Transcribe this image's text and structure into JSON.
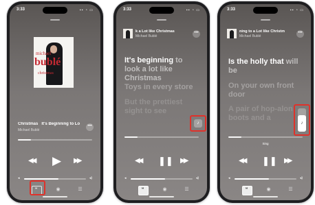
{
  "status": {
    "time_1": "3:33",
    "time_2": "3:33",
    "time_3": "3:33",
    "icons": "▪▪ ◔ ▭"
  },
  "now_playing": {
    "song": "Christmas",
    "song_full": "It's Beginning to Lo",
    "artist": "Michael Bublé",
    "artwork": {
      "line1": "michael",
      "line2": "bublé",
      "line3": "christmas"
    }
  },
  "mini_player_2": {
    "title": "k a Lot like Christmas",
    "artist": "Michael Bublé"
  },
  "mini_player_3": {
    "title": "ning to a Lot like Christm",
    "artist": "Michael Bublé"
  },
  "lyrics_2": {
    "current_lit": "It's beginning",
    "current_dim": " to look a lot like Christmas",
    "next_1": "Toys in every store",
    "next_2": "But the prettiest sight to see"
  },
  "lyrics_3": {
    "current_lit": "Is the holly that",
    "current_dim": " will be",
    "next_1": "On your own front door",
    "next_2": "A pair of hop-alon boots and a"
  },
  "sing_label": "Sing",
  "playback": {
    "progress": 0.18
  },
  "volume": {
    "level": 0.55
  },
  "icons": {
    "more": "•••",
    "prev": "◀◀",
    "play": "▶",
    "pause": "❚❚",
    "next": "▶▶",
    "lyrics": "❝",
    "airplay": "◉",
    "queue": "☰",
    "mic": "♪",
    "vol_lo": "◂",
    "vol_hi": "◂)"
  },
  "colors": {
    "highlight": "#e0312a"
  }
}
